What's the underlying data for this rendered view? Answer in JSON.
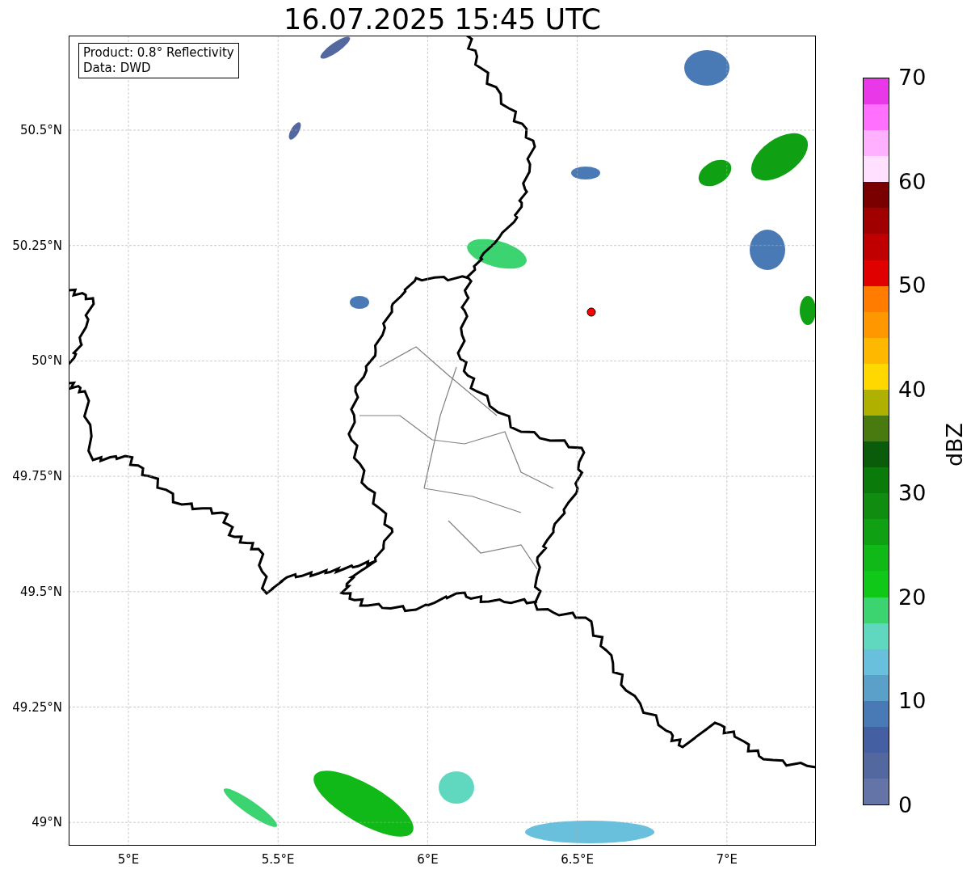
{
  "title": "16.07.2025 15:45 UTC",
  "info_box": [
    "Product: 0.8° Reflectivity",
    "Data: DWD"
  ],
  "map": {
    "y_ticks": [
      "50.5°N",
      "50.25°N",
      "50°N",
      "49.75°N",
      "49.5°N",
      "49.25°N",
      "49°N"
    ],
    "x_ticks": [
      "5°E",
      "5.5°E",
      "6°E",
      "6.5°E",
      "7°E"
    ]
  },
  "colorbar": {
    "label": "dBZ",
    "ticks": [
      "70",
      "60",
      "50",
      "40",
      "30",
      "20",
      "10",
      "0"
    ],
    "segments": [
      {
        "color": "#e838e8"
      },
      {
        "color": "#ff70ff"
      },
      {
        "color": "#ffb0ff"
      },
      {
        "color": "#ffe0ff"
      },
      {
        "color": "#7a0000"
      },
      {
        "color": "#a00000"
      },
      {
        "color": "#c00000"
      },
      {
        "color": "#e00000"
      },
      {
        "color": "#ff7c00"
      },
      {
        "color": "#ff9800"
      },
      {
        "color": "#ffb800"
      },
      {
        "color": "#ffd800"
      },
      {
        "color": "#b0b000"
      },
      {
        "color": "#487a10"
      },
      {
        "color": "#0a5c0a"
      },
      {
        "color": "#0a7a0a"
      },
      {
        "color": "#108c10"
      },
      {
        "color": "#10a014"
      },
      {
        "color": "#10b818"
      },
      {
        "color": "#10c818"
      },
      {
        "color": "#3cd470"
      },
      {
        "color": "#60d8c0"
      },
      {
        "color": "#68c0dc"
      },
      {
        "color": "#5aa0c8"
      },
      {
        "color": "#4a7ab5"
      },
      {
        "color": "#4460a2"
      },
      {
        "color": "#5468a0"
      },
      {
        "color": "#6474a6"
      }
    ]
  }
}
